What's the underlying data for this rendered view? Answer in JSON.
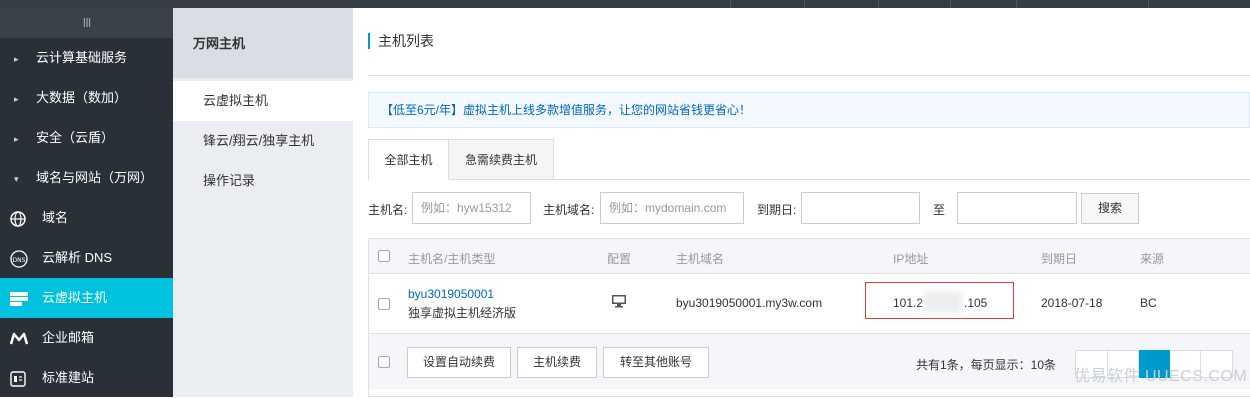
{
  "sidebar": {
    "handle": "III",
    "groups": [
      {
        "label": "云计算基础服务",
        "arrow": "▸"
      },
      {
        "label": "大数据（数加）",
        "arrow": "▸"
      },
      {
        "label": "安全（云盾）",
        "arrow": "▸"
      },
      {
        "label": "域名与网站（万网）",
        "arrow": "▾"
      }
    ],
    "items": [
      {
        "label": "域名",
        "icon": "globe-icon"
      },
      {
        "label": "云解析 DNS",
        "icon": "dns-icon"
      },
      {
        "label": "云虚拟主机",
        "icon": "server-icon",
        "active": true
      },
      {
        "label": "企业邮箱",
        "icon": "mail-icon"
      },
      {
        "label": "标准建站",
        "icon": "site-icon"
      }
    ]
  },
  "subnav": {
    "title": "万网主机",
    "items": [
      "云虚拟主机",
      "锋云/翔云/独享主机",
      "操作记录"
    ]
  },
  "main": {
    "title": "主机列表",
    "notice": "【低至6元/年】虚拟主机上线多款增值服务，让您的网站省钱更省心！",
    "tabs": [
      "全部主机",
      "急需续费主机"
    ],
    "search": {
      "host_label": "主机名:",
      "host_placeholder": "例如：hyw15312",
      "domain_label": "主机域名:",
      "domain_placeholder": "例如：mydomain.com",
      "expire_label": "到期日:",
      "to_label": "至",
      "search_button": "搜索"
    },
    "table": {
      "headers": [
        "主机名/主机类型",
        "配置",
        "主机域名",
        "IP地址",
        "到期日",
        "来源"
      ],
      "rows": [
        {
          "host": "byu3019050001",
          "type": "独享虚拟主机经济版",
          "domain": "byu3019050001.my3w.com",
          "ip_prefix": "101.2",
          "ip_suffix": ".105",
          "expire": "2018-07-18",
          "source": "BC"
        }
      ]
    },
    "footer": {
      "buttons": [
        "设置自动续费",
        "主机续费",
        "转至其他账号"
      ],
      "summary": "共有1条，每页显示：10条"
    }
  },
  "watermark": "优易软件 UUECS.COM",
  "colors": {
    "accent": "#00c1de",
    "sidebar": "#293038",
    "link": "#0066cc",
    "highlight": "#e4393c"
  }
}
